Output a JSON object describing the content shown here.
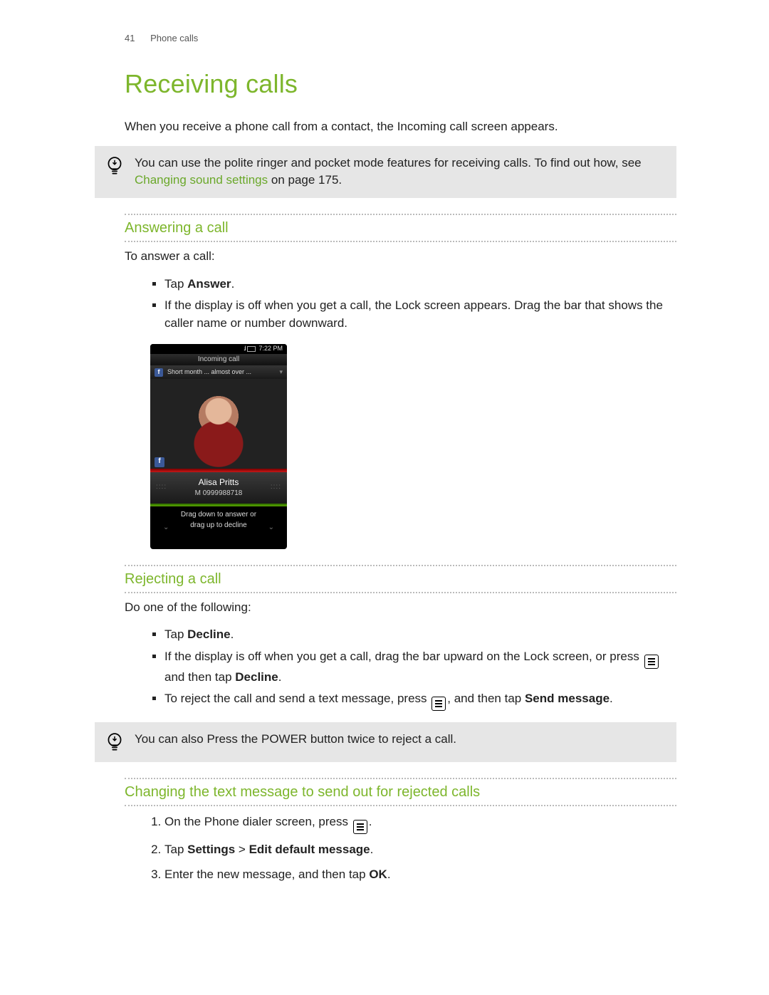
{
  "header": {
    "page_number": "41",
    "section": "Phone calls"
  },
  "title": "Receiving calls",
  "intro": "When you receive a phone call from a contact, the Incoming call screen appears.",
  "tip1": {
    "pre": "You can use the polite ringer and pocket mode features for receiving calls. To find out how, see ",
    "link": "Changing sound settings",
    "post": " on page 175."
  },
  "sec_answer": {
    "heading": "Answering a call",
    "lead": "To answer a call:",
    "b1_pre": "Tap ",
    "b1_bold": "Answer",
    "b1_post": ".",
    "b2": "If the display is off when you get a call, the Lock screen appears. Drag the bar that shows the caller name or number downward."
  },
  "phone": {
    "time": "7:22 PM",
    "signal": "..ıl",
    "bar_label": "Incoming call",
    "fb_text": "Short month ... almost over ...",
    "caller_name": "Alisa Pritts",
    "caller_number": "M 0999988718",
    "hint_l1": "Drag down to answer or",
    "hint_l2": "drag up to decline"
  },
  "sec_reject": {
    "heading": "Rejecting a call",
    "lead": "Do one of the following:",
    "b1_pre": "Tap ",
    "b1_bold": "Decline",
    "b1_post": ".",
    "b2_pre": "If the display is off when you get a call, drag the bar upward on the Lock screen, or press ",
    "b2_mid": " and then tap ",
    "b2_bold": "Decline",
    "b2_post": ".",
    "b3_pre": "To reject the call and send a text message, press ",
    "b3_mid": ", and then tap ",
    "b3_bold": "Send message",
    "b3_post": "."
  },
  "tip2": "You can also Press the POWER button twice to reject a call.",
  "sec_change": {
    "heading": "Changing the text message to send out for rejected calls",
    "s1_pre": "On the Phone dialer screen, press ",
    "s1_post": ".",
    "s2_pre": "Tap ",
    "s2_b1": "Settings",
    "s2_mid": " > ",
    "s2_b2": "Edit default message",
    "s2_post": ".",
    "s3_pre": "Enter the new message, and then tap ",
    "s3_bold": "OK",
    "s3_post": "."
  }
}
